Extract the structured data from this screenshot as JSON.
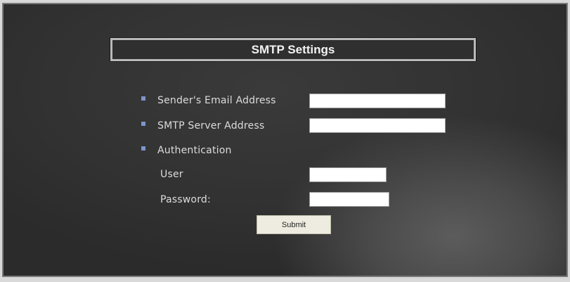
{
  "title": "SMTP Settings",
  "fields": {
    "sender_email": {
      "label": "Sender's Email Address",
      "value": ""
    },
    "smtp_server": {
      "label": "SMTP Server Address",
      "value": ""
    },
    "authentication": {
      "label": "Authentication"
    },
    "user": {
      "label": "User",
      "value": ""
    },
    "password": {
      "label": "Password:",
      "value": ""
    }
  },
  "submit_label": "Submit",
  "colors": {
    "bullet": "#7d95c9",
    "panel_background": "#2e2e2e",
    "title_border": "#b9b9b9",
    "text": "#dcdcdc",
    "button_background": "#eeece0"
  }
}
